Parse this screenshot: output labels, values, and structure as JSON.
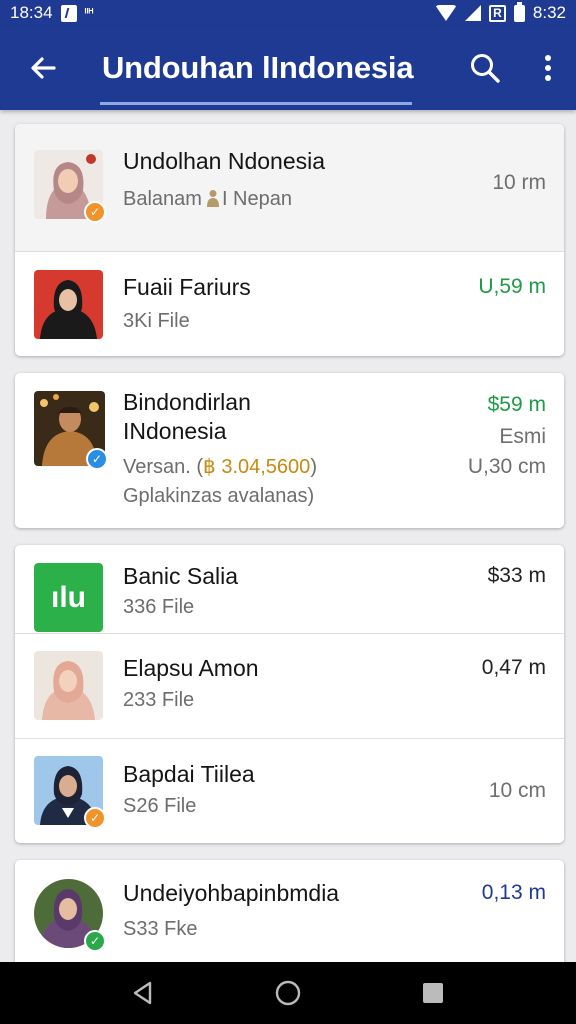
{
  "status_bar": {
    "time_left": "18:34",
    "small_text": "ᴵᴵᴴ",
    "time_right": "8:32"
  },
  "app_bar": {
    "title": "Undouhan lIndonesia"
  },
  "cards": [
    {
      "rows": [
        {
          "name": "Undolhan Ndonesia",
          "sub_before": "Balanam",
          "sub_after": "I Nepan",
          "meta": "10 rm",
          "badge": "orange"
        },
        {
          "name": "Fuaii Fariurs",
          "sub": "3Ki File",
          "meta": "U,59 m",
          "meta_color": "green"
        }
      ]
    },
    {
      "rows": [
        {
          "name_line1": "Bindondirlan",
          "name_line2": "INdonesia",
          "sub_before": "Versan. (",
          "sub_hl": "฿ 3.04,5600",
          "sub_after": ")",
          "sub2": "Gplakinzas avalanas)",
          "meta1": "$59 m",
          "meta2": "Esmi",
          "meta3": "U,30 cm",
          "badge": "blue"
        }
      ]
    },
    {
      "rows": [
        {
          "name": "Banic Salia",
          "sub": "336 File",
          "meta": "$33 m",
          "avatar_text": "ılu"
        },
        {
          "name": "Elapsu Amon",
          "sub": "233 File",
          "meta": "0,47 m"
        },
        {
          "name": "Bapdai Tiilea",
          "sub": "S26 File",
          "meta": "10 cm",
          "badge": "orange"
        }
      ]
    },
    {
      "rows": [
        {
          "name": "Undeiyohbapinbmdia",
          "sub": "S33 Fke",
          "meta": "0,13 m",
          "badge": "green"
        }
      ]
    }
  ],
  "colors": {
    "primary": "#1f3a93",
    "accent_green": "#1f9a45",
    "highlight_gold": "#c88a10"
  }
}
